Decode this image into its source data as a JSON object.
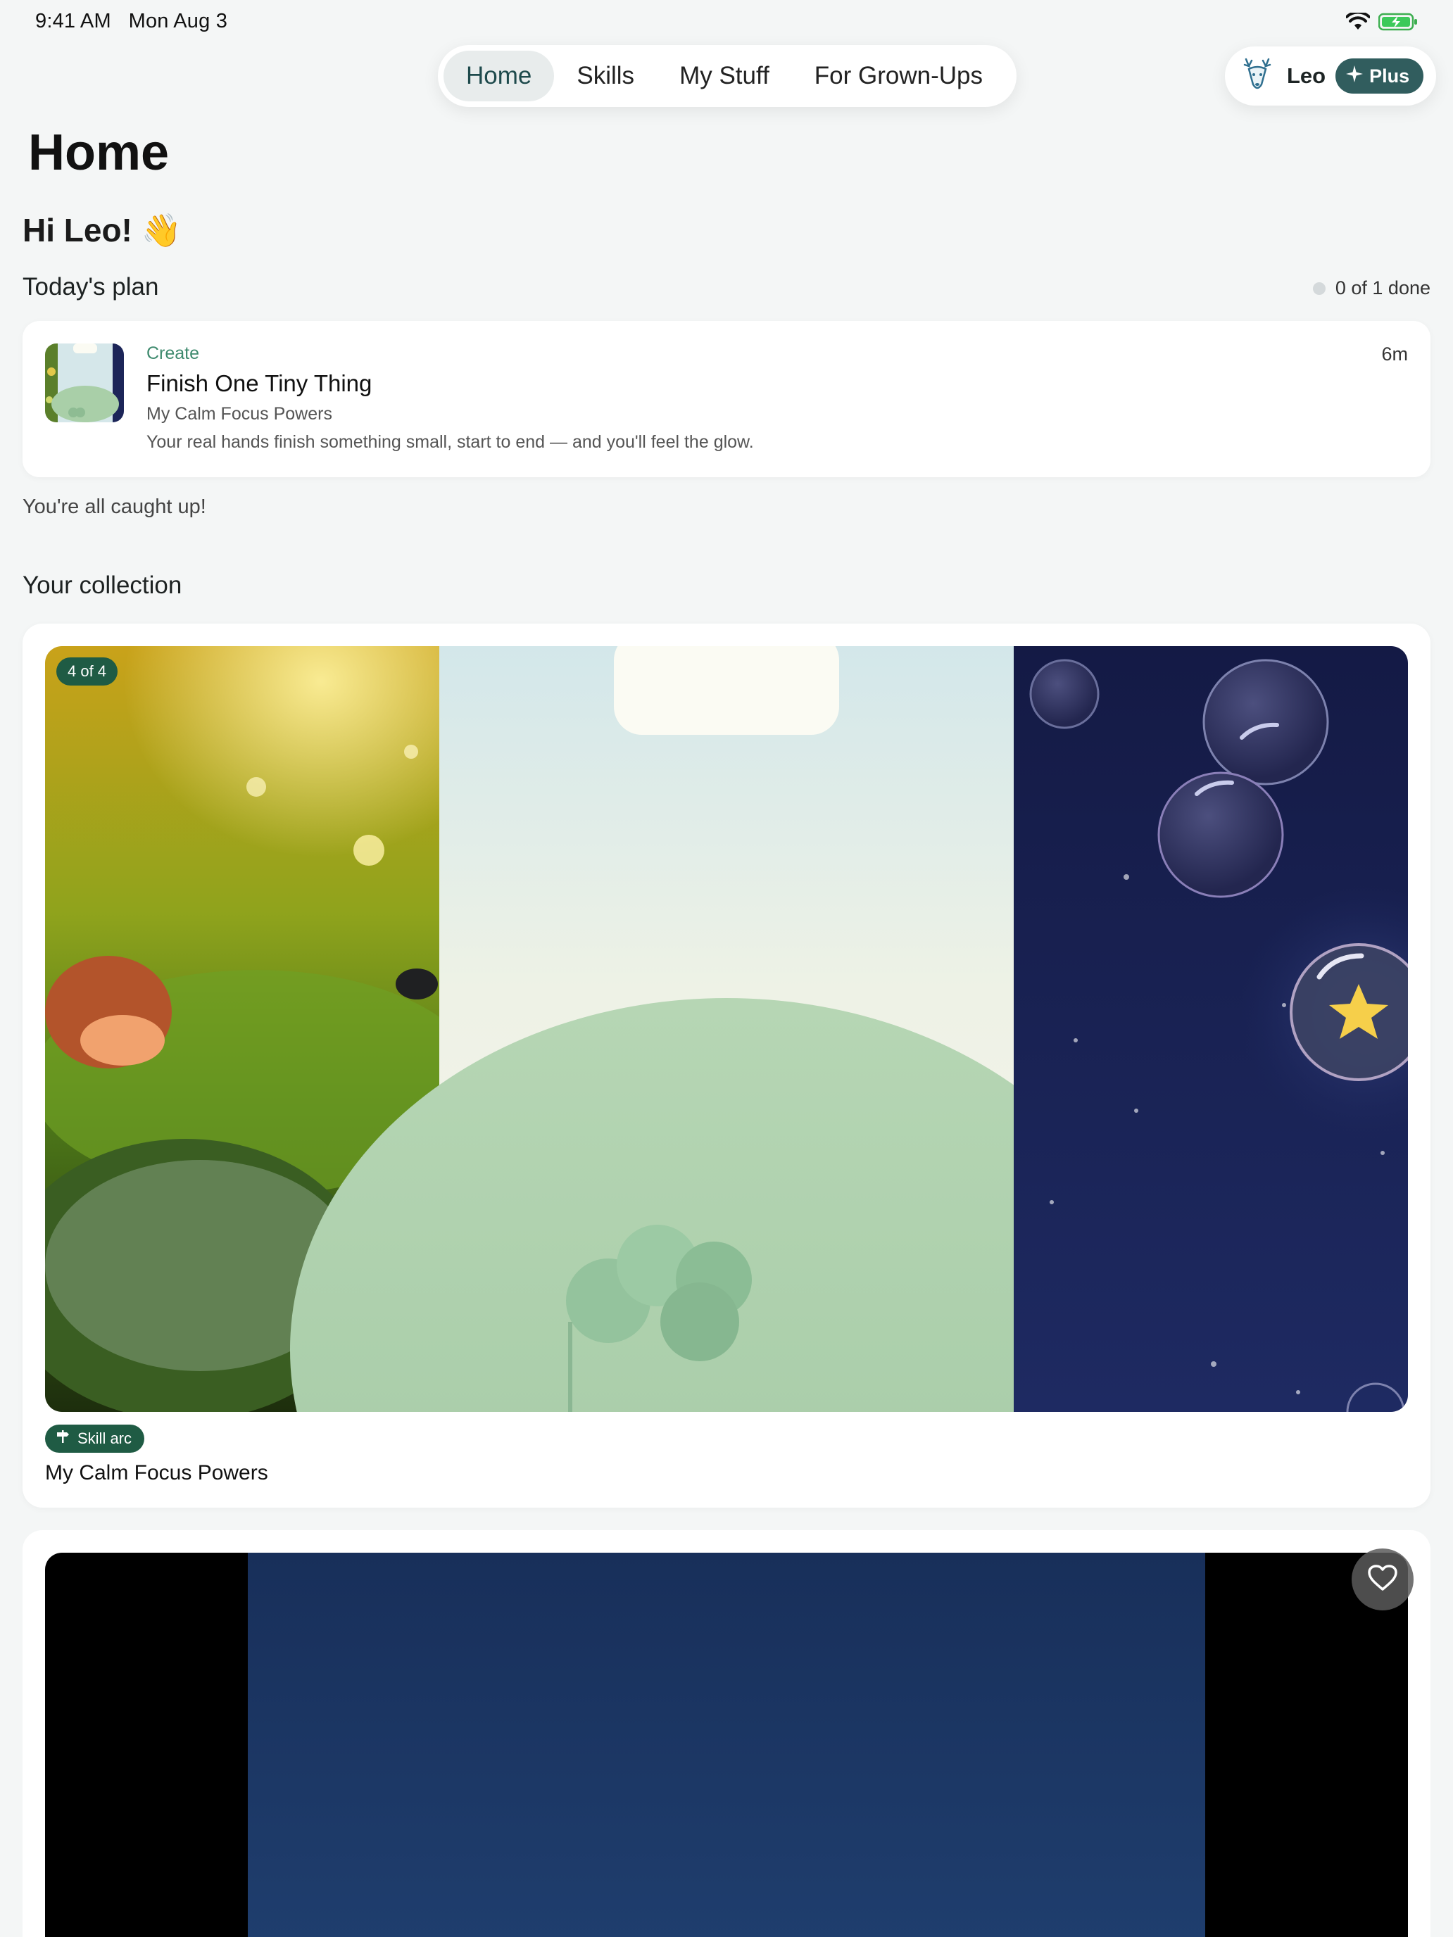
{
  "status_bar": {
    "time": "9:41 AM",
    "date": "Mon Aug 3"
  },
  "nav": {
    "tabs": [
      {
        "label": "Home"
      },
      {
        "label": "Skills"
      },
      {
        "label": "My Stuff"
      },
      {
        "label": "For Grown-Ups"
      }
    ],
    "active_tab": "Home"
  },
  "profile": {
    "name": "Leo",
    "plan_badge": "Plus"
  },
  "page": {
    "title": "Home",
    "greeting": "Hi Leo! 👋"
  },
  "todays_plan": {
    "heading": "Today's plan",
    "progress": "0 of 1 done",
    "items": [
      {
        "kicker": "Create",
        "title": "Finish One Tiny Thing",
        "subtitle": "My Calm Focus Powers",
        "description": "Your real hands finish something small, start to end — and you'll feel the glow.",
        "duration": "6m"
      }
    ],
    "caught_up": "You're all caught up!"
  },
  "collection": {
    "heading": "Your collection",
    "cards": [
      {
        "count_badge": "4 of 4",
        "tag": "Skill arc",
        "title": "My Calm Focus Powers"
      }
    ]
  },
  "colors": {
    "accent": "#1f5b44",
    "plus_badge": "#315d5e",
    "active_tab_text": "#1e4a4c",
    "background": "#f4f6f6"
  },
  "icons": [
    "wifi-icon",
    "battery-charging-icon",
    "deer-avatar-icon",
    "sparkle-icon",
    "signpost-icon",
    "heart-icon"
  ]
}
